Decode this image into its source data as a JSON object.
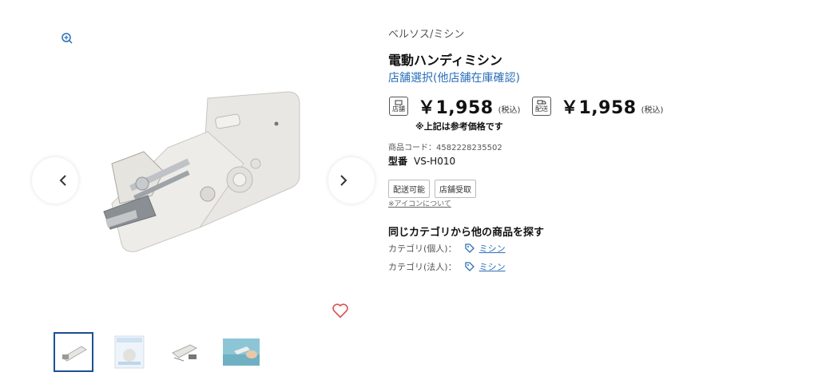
{
  "product": {
    "brand": "ベルソス/ミシン",
    "title": "電動ハンディミシン",
    "store_link": "店舗選択(他店舗在庫確認)",
    "prices": [
      {
        "badge": "店舗",
        "price": "￥1,958",
        "tax": "(税込)"
      },
      {
        "badge": "配送",
        "price": "￥1,958",
        "tax": "(税込)"
      }
    ],
    "price_note": "※上記は参考価格です",
    "code_label": "商品コード：4582228235502",
    "model_label": "型番",
    "model_value": "VS-H010",
    "tags": [
      "配送可能",
      "店舗受取"
    ],
    "icon_link": "※アイコンについて"
  },
  "related": {
    "heading": "同じカテゴリから他の商品を探す",
    "rows": [
      {
        "label": "カテゴリ(個人)：",
        "link": "ミシン"
      },
      {
        "label": "カテゴリ(法人)：",
        "link": "ミシン"
      }
    ]
  },
  "gallery": {
    "thumbnail_count": 4,
    "active_index": 0,
    "icons": [
      "zoom-in-icon",
      "chevron-left-icon",
      "chevron-right-icon",
      "heart-icon"
    ]
  },
  "colors": {
    "accent": "#2a6fb8",
    "active_border": "#1b4f93",
    "heart": "#d9534f"
  }
}
